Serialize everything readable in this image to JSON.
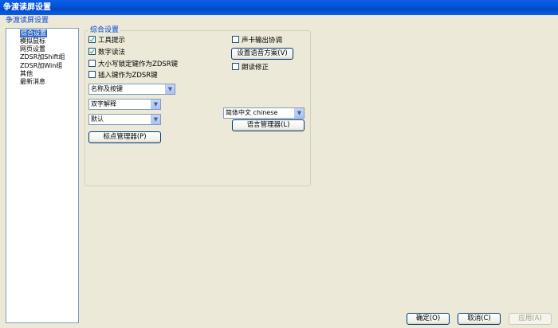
{
  "window": {
    "title": "争渡读屏设置"
  },
  "menu": {
    "label": "争渡读屏设置"
  },
  "tree": {
    "items": [
      "综合设置",
      "模拟鼠标",
      "网页设置",
      "ZDSR加Shift组",
      "ZDSR加Win组",
      "其他",
      "最新消息"
    ]
  },
  "general": {
    "group_title": "综合设置",
    "tooltip": {
      "label": "工具提示",
      "checked": true
    },
    "digit_reading": {
      "label": "数字读法",
      "checked": true
    },
    "capslock_zdsr": {
      "label": "大小写锁定键作为ZDSR键",
      "checked": false
    },
    "insert_zdsr": {
      "label": "插入键作为ZDSR键",
      "checked": false
    },
    "name_key_select": "名称及按键",
    "double_char_select": "双字解释",
    "default_select": "默认",
    "punctuation_button": "标点管理器(P)",
    "soundcard_coord": {
      "label": "声卡输出协调",
      "checked": false
    },
    "voice_scheme_button": "设置语音方案(V)",
    "reading_correction": {
      "label": "朗读修正",
      "checked": false
    },
    "language_select": "简体中文 chinese",
    "language_manager_button": "语言管理器(L)"
  },
  "footer": {
    "ok": "确定(O)",
    "cancel": "取消(C)",
    "apply": "应用(A)"
  }
}
